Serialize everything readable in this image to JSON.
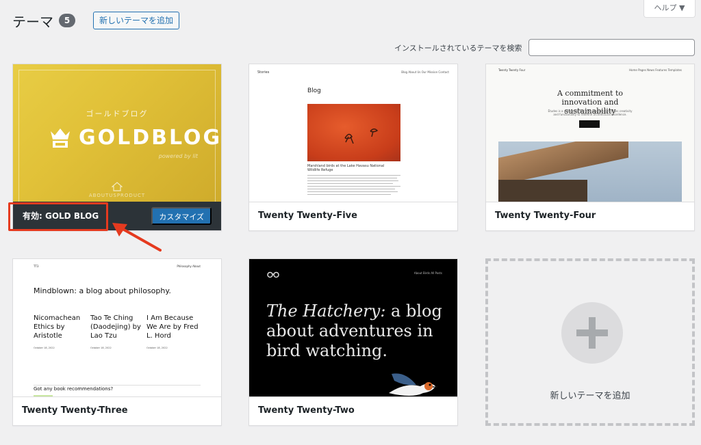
{
  "header": {
    "title": "テーマ",
    "count": "5",
    "add_button": "新しいテーマを追加",
    "help_button": "ヘルプ ▼",
    "search_label": "インストールされているテーマを検索",
    "search_value": ""
  },
  "active_theme": {
    "name": "有効: GOLD BLOG",
    "customize_button": "カスタマイズ",
    "thumbnail": {
      "top_text": "ゴールドブログ",
      "logo_text": "GOLDBLOG",
      "sub_text": "powered by lit",
      "bottom_text": "ABOUTUSPRODUCT"
    }
  },
  "themes": [
    {
      "name": "Twenty Twenty-Five",
      "thumbnail": {
        "site": "Stories",
        "nav": "Blog  About Us  Our Mission  Contact",
        "heading": "Blog",
        "caption": "Marshland birds at the Lake Havasu National Wildlife Refuge"
      }
    },
    {
      "name": "Twenty Twenty-Four",
      "thumbnail": {
        "site": "Twenty Twenty Four",
        "nav": "Home  Pages  News  Features  Templates",
        "heading": "A commitment to innovation and sustainability",
        "text": "Études is a pioneering firm that seamlessly merges creativity and functionality to redefine architectural excellence."
      }
    },
    {
      "name": "Twenty Twenty-Three",
      "thumbnail": {
        "site": "TT3",
        "nav": "Philosophy  About",
        "heading": "Mindblown: a blog about philosophy.",
        "posts": [
          "Nicomachean Ethics by Aristotle",
          "Tao Te Ching (Daodejing) by Lao Tzu",
          "I Am Because We Are by Fred L. Hord"
        ],
        "post_date": "October 18, 2022",
        "question": "Got any book recommendations?"
      }
    },
    {
      "name": "Twenty Twenty-Two",
      "thumbnail": {
        "nav": "About   Birds   All Posts",
        "heading_italic": "The Hatchery:",
        "heading_rest": " a blog about adventures in bird watching."
      }
    }
  ],
  "add_new": {
    "label": "新しいテーマを追加",
    "icon": "plus-icon"
  },
  "colors": {
    "accent": "#2271b1",
    "highlight": "#e53a1f",
    "active_footer": "#2c3338"
  }
}
